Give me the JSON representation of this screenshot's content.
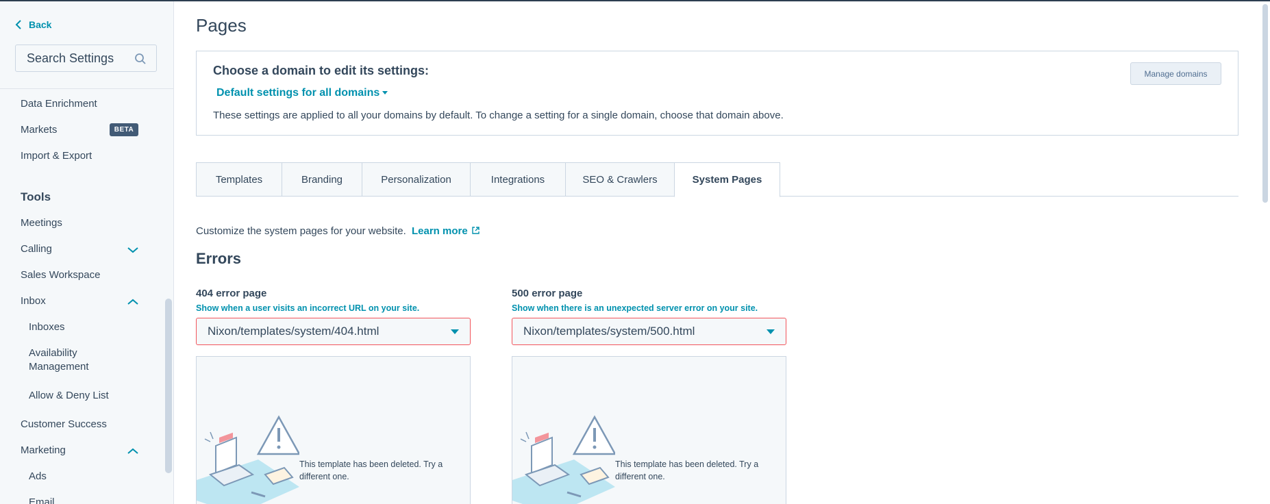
{
  "sidebar": {
    "back_label": "Back",
    "search_placeholder": "Search Settings",
    "items": [
      {
        "label": "Data Enrichment"
      },
      {
        "label": "Markets",
        "badge": "BETA"
      },
      {
        "label": "Import & Export"
      }
    ],
    "tools_heading": "Tools",
    "tools": [
      {
        "label": "Meetings"
      },
      {
        "label": "Calling",
        "expanded": false
      },
      {
        "label": "Sales Workspace"
      },
      {
        "label": "Inbox",
        "expanded": true
      },
      {
        "label": "Inboxes"
      },
      {
        "label": "Availability Management",
        "line1": "Availability",
        "line2": "Management"
      },
      {
        "label": "Allow & Deny List"
      },
      {
        "label": "Customer Success"
      },
      {
        "label": "Marketing",
        "expanded": true
      },
      {
        "label": "Ads"
      },
      {
        "label": "Email"
      }
    ]
  },
  "main": {
    "title": "Pages",
    "domain": {
      "heading": "Choose a domain to edit its settings:",
      "selected": "Default settings for all domains",
      "description": "These settings are applied to all your domains by default. To change a setting for a single domain, choose that domain above.",
      "manage_button": "Manage domains"
    },
    "tabs": [
      {
        "label": "Templates"
      },
      {
        "label": "Branding"
      },
      {
        "label": "Personalization"
      },
      {
        "label": "Integrations"
      },
      {
        "label": "SEO & Crawlers"
      },
      {
        "label": "System Pages",
        "active": true
      }
    ],
    "intro": "Customize the system pages for your website.",
    "learn_more": "Learn more",
    "errors_heading": "Errors",
    "error_pages": [
      {
        "title": "404 error page",
        "subtitle": "Show when a user visits an incorrect URL on your site.",
        "template": "Nixon/templates/system/404.html",
        "preview_message": "This template has been deleted. Try a different one."
      },
      {
        "title": "500 error page",
        "subtitle": "Show when there is an unexpected server error on your site.",
        "template": "Nixon/templates/system/500.html",
        "preview_message": "This template has been deleted. Try a different one."
      }
    ]
  },
  "colors": {
    "accent": "#0091ae",
    "text": "#33475b",
    "error_border": "#f2545b",
    "sidebar_bg": "#f5f8fa",
    "badge_bg": "#425b76"
  },
  "icons": [
    "chevron-left-icon",
    "search-icon",
    "chevron-down-icon",
    "chevron-up-icon",
    "external-link-icon",
    "dropdown-caret-icon",
    "warning-illustration"
  ]
}
